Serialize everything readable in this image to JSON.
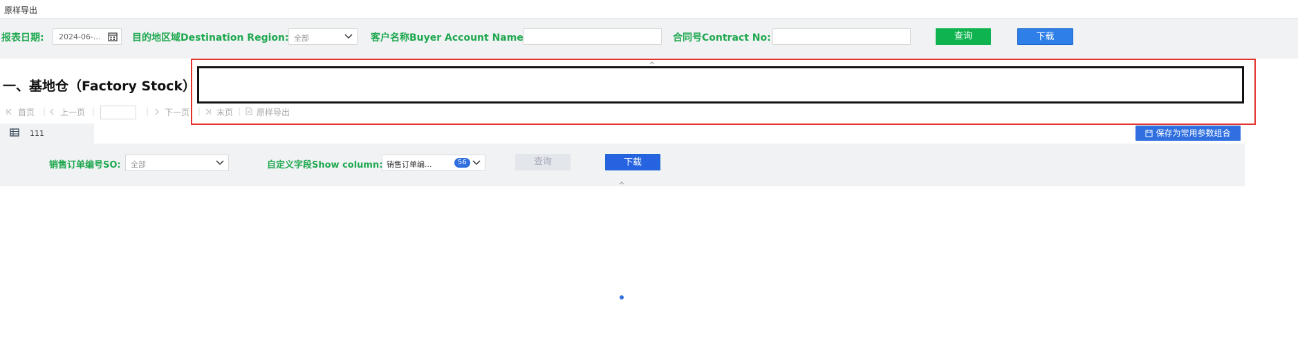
{
  "topbar": {
    "title": "原样导出"
  },
  "filters": {
    "report_date_label": "报表日期:",
    "report_date_value": "2024-06-...",
    "region_label": "目的地区域Destination Region:",
    "region_value": "全部",
    "buyer_label": "客户名称Buyer Account Name:",
    "buyer_value": "",
    "contract_label": "合同号Contract No:",
    "contract_value": "",
    "query_label": "查询",
    "download_label": "下载"
  },
  "section": {
    "title": "一、基地仓（Factory Stock）"
  },
  "pager": {
    "first": "首页",
    "prev": "上一页",
    "page_value": "",
    "next": "下一页",
    "last": "末页",
    "export": "原样导出"
  },
  "row": {
    "id": "111",
    "save_label": "保存为常用参数组合"
  },
  "panel": {
    "so_label": "销售订单编号SO:",
    "so_value": "全部",
    "column_label": "自定义字段Show column:",
    "column_value": "销售订单编...",
    "column_count": "56",
    "query_label": "查询",
    "download_label": "下载"
  },
  "colors": {
    "green": "#1fa84f",
    "blue": "#2f7fe8",
    "highlight": "#e5312d"
  }
}
